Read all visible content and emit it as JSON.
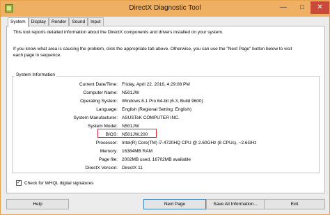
{
  "window": {
    "title": "DirectX Diagnostic Tool",
    "minimize_glyph": "—",
    "maximize_glyph": "□",
    "close_glyph": "✕",
    "border_color": "#e5a04a",
    "close_color": "#c94a3b"
  },
  "tabs": [
    {
      "label": "System",
      "active": true
    },
    {
      "label": "Display",
      "active": false
    },
    {
      "label": "Render",
      "active": false
    },
    {
      "label": "Sound",
      "active": false
    },
    {
      "label": "Input",
      "active": false
    }
  ],
  "intro": {
    "line1": "This tool reports detailed information about the DirectX components and drivers installed on your system.",
    "line2": "If you know what area is causing the problem, click the appropriate tab above.  Otherwise, you can use the \"Next Page\" button below to visit",
    "line3": "each page in sequence."
  },
  "system_info": {
    "group_label": "System Information",
    "rows": [
      {
        "label": "Current Date/Time:",
        "value": "Friday, April 22, 2016, 4:29:08 PM"
      },
      {
        "label": "Computer Name:",
        "value": "N501JW"
      },
      {
        "label": "Operating System:",
        "value": "Windows 8.1 Pro 64-bit (6.3, Build 9600)"
      },
      {
        "label": "Language:",
        "value": "English (Regional Setting: English)"
      },
      {
        "label": "System Manufacturer:",
        "value": "ASUSTeK COMPUTER INC."
      },
      {
        "label": "System Model:",
        "value": "N501JW"
      },
      {
        "label": "BIOS:",
        "value": "N501JW.200"
      },
      {
        "label": "Processor:",
        "value": "Intel(R) Core(TM) i7-4720HQ CPU @ 2.60GHz (8 CPUs), ~2.6GHz"
      },
      {
        "label": "Memory:",
        "value": "16384MB RAM"
      },
      {
        "label": "Page file:",
        "value": "2002MB used, 16702MB available"
      },
      {
        "label": "DirectX Version:",
        "value": "DirectX 11"
      }
    ],
    "highlight_color": "#e0202a"
  },
  "whql": {
    "label": "Check for WHQL digital signatures",
    "checked": true
  },
  "buttons": {
    "help": "Help",
    "next_page": "Next Page",
    "save_all": "Save All Information...",
    "exit": "Exit"
  }
}
